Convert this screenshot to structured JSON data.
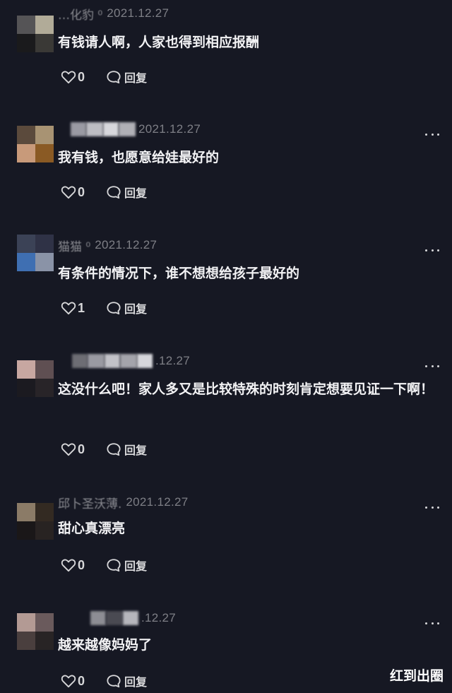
{
  "comments": [
    {
      "name": "…化豹 ⁰",
      "date": "2021.12.27",
      "text": "有钱请人啊，人家也得到相应报酬",
      "likes": "0",
      "reply_label": "回复",
      "avatar_colors": [
        "#555456",
        "#b1ab98",
        "#1a1a1c",
        "#3a3936"
      ],
      "name_blocks": []
    },
    {
      "name": "",
      "date": "2021.12.27",
      "text": "我有钱，也愿意给娃最好的",
      "likes": "0",
      "reply_label": "回复",
      "avatar_colors": [
        "#5b4a3c",
        "#a89373",
        "#c89a7a",
        "#8a5a24"
      ],
      "name_blocks": [
        "#9a9aa3",
        "#bdbdc3",
        "#d7d7dc",
        "#b0b0b6"
      ]
    },
    {
      "name": "猫猫 ⁰",
      "date": "2021.12.27",
      "text": "有条件的情况下，谁不想想给孩子最好的",
      "likes": "1",
      "reply_label": "回复",
      "avatar_colors": [
        "#3b4256",
        "#2f3246",
        "#3f6fb2",
        "#8a93a7"
      ],
      "name_blocks": []
    },
    {
      "name": "",
      "date": ".12.27",
      "text": "这没什么吧！家人多又是比较特殊的时刻肯定想要见证一下啊！",
      "likes": "0",
      "reply_label": "回复",
      "avatar_colors": [
        "#c7a7a1",
        "#5f4f52",
        "#1b1a20",
        "#282428"
      ],
      "name_blocks": [
        "#6d6d74",
        "#9a9aa2",
        "#c2c2c8",
        "#a4a4ab",
        "#d6d6db"
      ]
    },
    {
      "name": "邱卜圣沃薄.",
      "date": "2021.12.27",
      "text": "甜心真漂亮",
      "likes": "0",
      "reply_label": "回复",
      "avatar_colors": [
        "#8b7b67",
        "#332a22",
        "#1a1718",
        "#282322"
      ],
      "name_blocks": []
    },
    {
      "name": "",
      "date": ".12.27",
      "text": "越来越像妈妈了",
      "likes": "0",
      "reply_label": "回复",
      "avatar_colors": [
        "#b39a94",
        "#6a5a5c",
        "#4a3f3e",
        "#282425"
      ],
      "name_blocks": [
        "#8d8d94",
        "#4a4a52",
        "#b6b6bc"
      ]
    }
  ],
  "watermark": "红到出圈",
  "icons": {
    "like": "heart-outline-icon",
    "reply": "speech-bubble-icon",
    "more": "more-dots-icon"
  },
  "colors": {
    "background": "#161823",
    "text": "#f2f2f4",
    "meta": "#7e7f86"
  }
}
